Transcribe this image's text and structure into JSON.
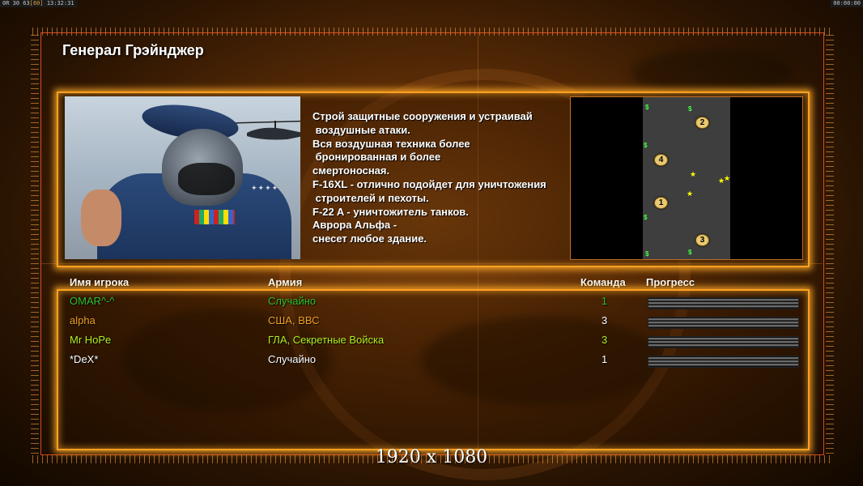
{
  "system_bar": {
    "left_prefix": "0R",
    "left_stats": "30 63",
    "left_highlight": "[60]",
    "left_time": "13:32:31",
    "right_time": "00:00:00"
  },
  "general": {
    "title": "Генерал Грэйнджер",
    "description": "Строй защитные сооружения и устраивай\n воздушные атаки.\nВся воздушная техника более\n бронированная и более\nсмертоносная.\nF-16XL - отлично подойдет для уничтожения\n строителей и пехоты.\nF-22 A - уничтожитель танков.\nАврора Альфа -\nснесет любое здание."
  },
  "minimap": {
    "start_positions": [
      "2",
      "4",
      "1",
      "3"
    ],
    "cash_icon": "$",
    "oil_icon": "★"
  },
  "table": {
    "headers": {
      "player": "Имя игрока",
      "army": "Армия",
      "team": "Команда",
      "progress": "Прогресс"
    },
    "rows": [
      {
        "name": "OMAR^-^",
        "army": "Случайно",
        "team": "1",
        "color": "#30c030",
        "army_color": "#30c030",
        "team_color": "#30c030",
        "progress": 1.0
      },
      {
        "name": "alpha",
        "army": "США, ВВС",
        "team": "3",
        "color": "#f0a020",
        "army_color": "#f0a020",
        "team_color": "#ffffff",
        "progress": 1.0
      },
      {
        "name": "Mr HoPe",
        "army": "ГЛА, Секретные Войска",
        "team": "3",
        "color": "#b0f020",
        "army_color": "#b0f020",
        "team_color": "#b0f020",
        "progress": 1.0
      },
      {
        "name": "*DeX*",
        "army": "Случайно",
        "team": "1",
        "color": "#ffffff",
        "army_color": "#ffffff",
        "team_color": "#ffffff",
        "progress": 1.0
      }
    ]
  },
  "resolution_label": "1920 x 1080",
  "colors": {
    "frame": "#ffa020",
    "accent": "#ff5a28"
  }
}
